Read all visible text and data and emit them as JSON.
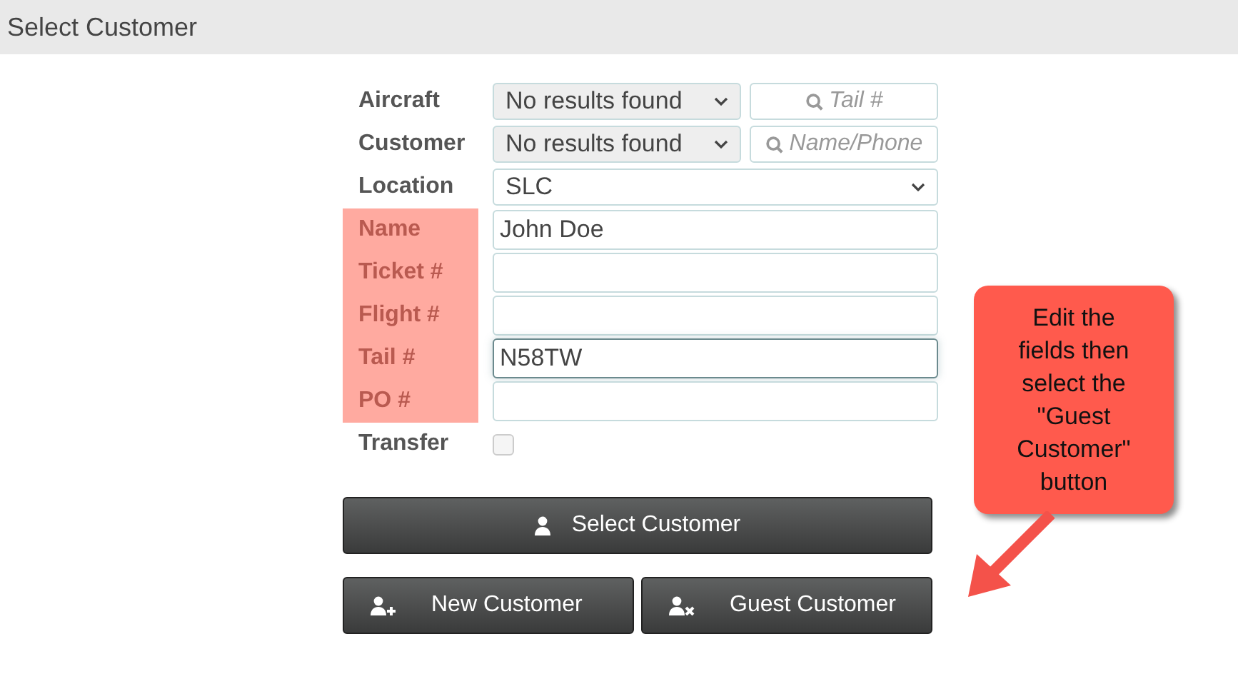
{
  "header": {
    "title": "Select Customer"
  },
  "rows": [
    {
      "label": "Aircraft",
      "kind": "select-search",
      "highlighted": false,
      "value": "No results found",
      "disabled": true,
      "search_placeholder": "Tail #"
    },
    {
      "label": "Customer",
      "kind": "select-search",
      "highlighted": false,
      "value": "No results found",
      "disabled": true,
      "search_placeholder": "Name/Phone"
    },
    {
      "label": "Location",
      "kind": "select",
      "highlighted": false,
      "value": "SLC",
      "disabled": false
    },
    {
      "label": "Name",
      "kind": "text",
      "highlighted": true,
      "value": "John Doe",
      "focused": false
    },
    {
      "label": "Ticket #",
      "kind": "text",
      "highlighted": true,
      "focused": false
    },
    {
      "label": "Flight #",
      "kind": "text",
      "highlighted": true,
      "focused": false
    },
    {
      "label": "Tail #",
      "kind": "text",
      "highlighted": true,
      "value": "N58TW",
      "focused": true
    },
    {
      "label": "PO #",
      "kind": "text",
      "highlighted": true,
      "focused": false
    },
    {
      "label": "Transfer",
      "kind": "checkbox",
      "highlighted": false,
      "checked": false
    }
  ],
  "buttons": [
    {
      "label": "Select Customer",
      "kind": "select"
    },
    {
      "label": "New Customer",
      "kind": "new"
    },
    {
      "label": "Guest Customer",
      "kind": "guest"
    }
  ],
  "callout": {
    "text": "Edit the fields then select the \"Guest Customer\" button"
  }
}
